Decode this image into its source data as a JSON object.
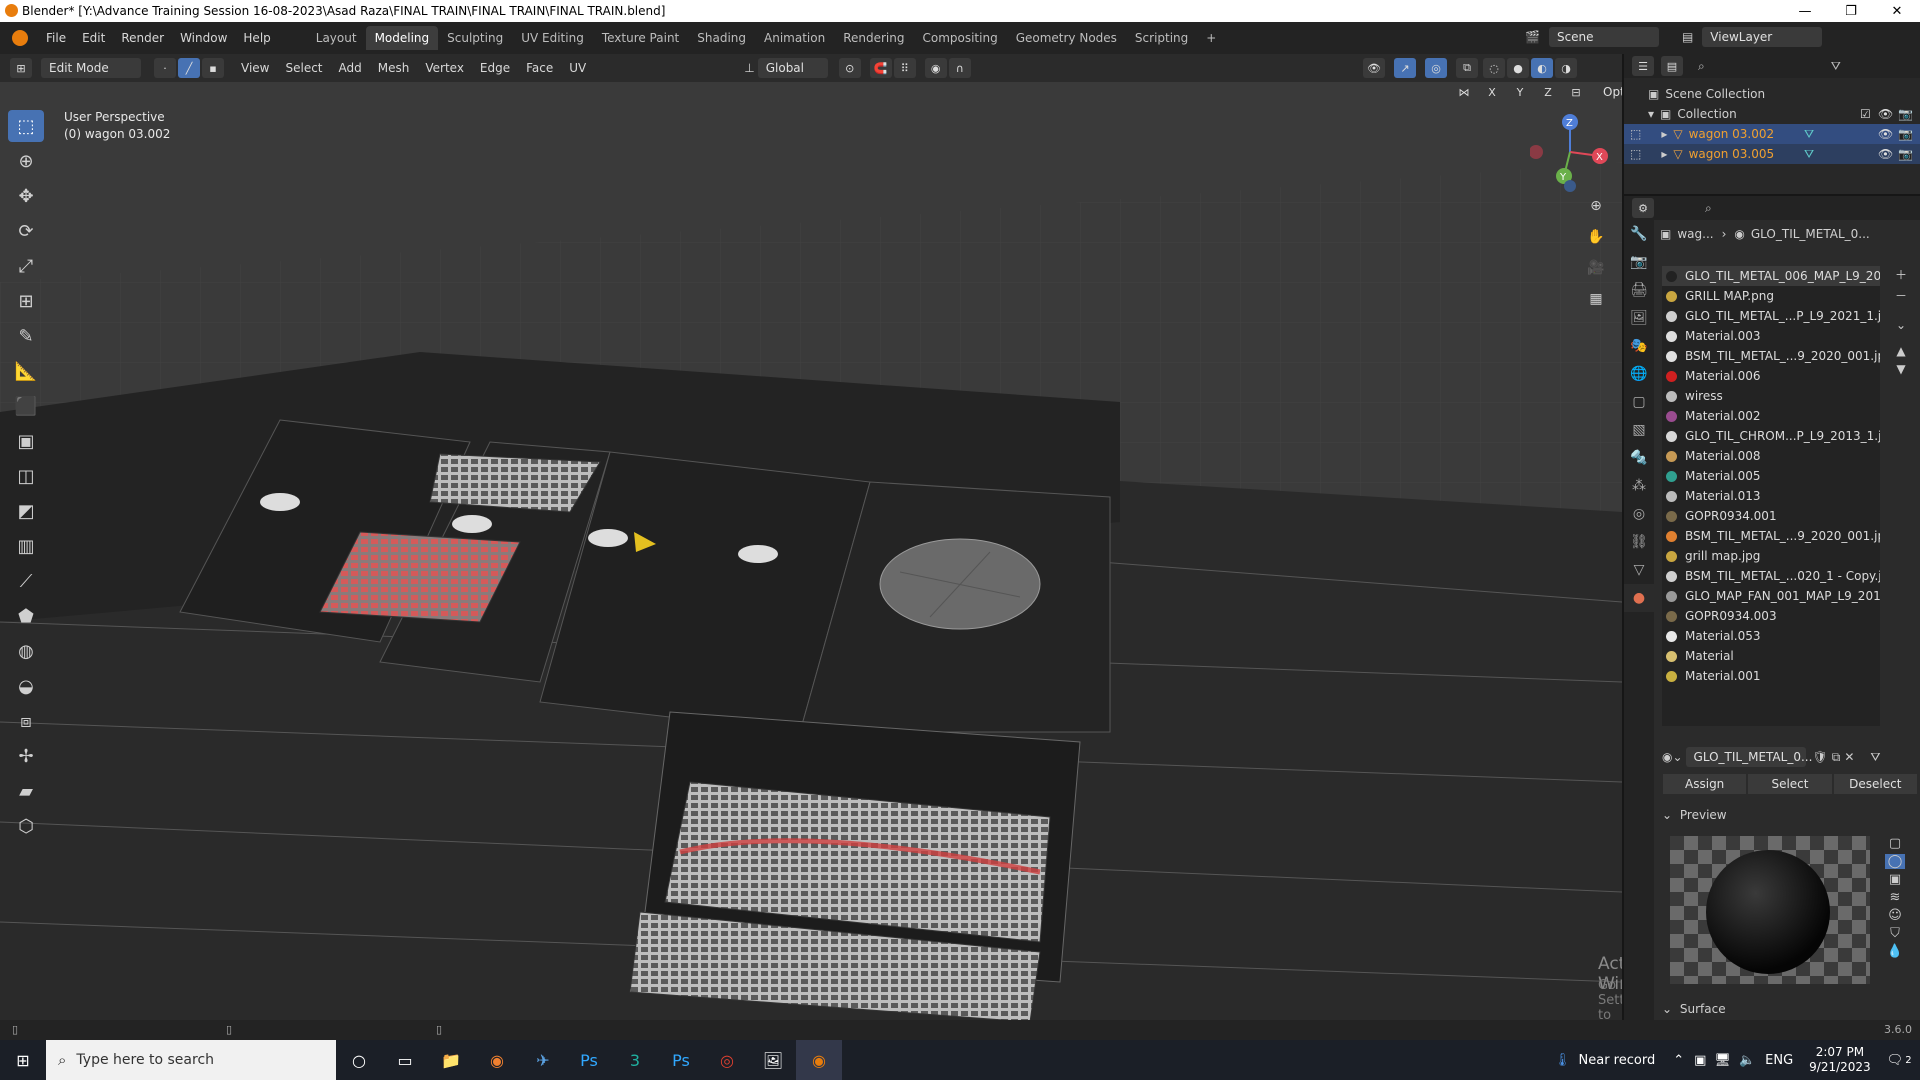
{
  "window": {
    "title": "Blender* [Y:\\Advance Training Session 16-08-2023\\Asad Raza\\FINAL TRAIN\\FINAL TRAIN\\FINAL TRAIN.blend]",
    "min": "—",
    "max": "❐",
    "close": "✕"
  },
  "menu": [
    "File",
    "Edit",
    "Render",
    "Window",
    "Help"
  ],
  "workspaces": [
    "Layout",
    "Modeling",
    "Sculpting",
    "UV Editing",
    "Texture Paint",
    "Shading",
    "Animation",
    "Rendering",
    "Compositing",
    "Geometry Nodes",
    "Scripting"
  ],
  "workspace_add": "+",
  "scene": {
    "name": "Scene",
    "view_layer": "ViewLayer"
  },
  "viewport_header": {
    "mode": "Edit Mode",
    "menus": [
      "View",
      "Select",
      "Add",
      "Mesh",
      "Vertex",
      "Edge",
      "Face",
      "UV"
    ],
    "orientation": "Global",
    "options": "Options",
    "axes": [
      "X",
      "Y",
      "Z"
    ]
  },
  "viewport": {
    "perspective": "User Perspective",
    "object": "(0) wagon 03.002",
    "watermark_title": "Activate Windows",
    "watermark_sub": "Go to Settings to activate Windows.",
    "gizmo": {
      "x": "X",
      "y": "Y",
      "z": "Z"
    }
  },
  "outliner": {
    "root": "Scene Collection",
    "collection": "Collection",
    "items": [
      {
        "name": "wagon 03.002",
        "selected": true
      },
      {
        "name": "wagon 03.005",
        "selected": false
      }
    ]
  },
  "properties": {
    "breadcrumb_obj": "wag...",
    "breadcrumb_mat": "GLO_TIL_METAL_0...",
    "materials": [
      {
        "name": "GLO_TIL_METAL_006_MAP_L9_20...",
        "color": "#222222",
        "active": true
      },
      {
        "name": "GRILL MAP.png",
        "color": "#c9a640"
      },
      {
        "name": "GLO_TIL_METAL_...P_L9_2021_1.jpg",
        "color": "#cfcfcf"
      },
      {
        "name": "Material.003",
        "color": "#dedede"
      },
      {
        "name": "BSM_TIL_METAL_...9_2020_001.jpg",
        "color": "#e0e0e0"
      },
      {
        "name": "Material.006",
        "color": "#d02020"
      },
      {
        "name": "wiress",
        "color": "#bdbdbd"
      },
      {
        "name": "Material.002",
        "color": "#9a4c90"
      },
      {
        "name": "GLO_TIL_CHROM...P_L9_2013_1.jpg",
        "color": "#d8d8d8"
      },
      {
        "name": "Material.008",
        "color": "#c79a55"
      },
      {
        "name": "Material.005",
        "color": "#30a090"
      },
      {
        "name": "Material.013",
        "color": "#bcbcbc"
      },
      {
        "name": "GOPR0934.001",
        "color": "#7a6a4a"
      },
      {
        "name": "BSM_TIL_METAL_...9_2020_001.jpg",
        "color": "#e08030"
      },
      {
        "name": "grill map.jpg",
        "color": "#c9a640"
      },
      {
        "name": "BSM_TIL_METAL_...020_1 - Copy.jpg",
        "color": "#d0d0d0"
      },
      {
        "name": "GLO_MAP_FAN_001_MAP_L9_201...",
        "color": "#9a9a9a"
      },
      {
        "name": "GOPR0934.003",
        "color": "#7a6a4a"
      },
      {
        "name": "Material.053",
        "color": "#e8e8e8"
      },
      {
        "name": "Material",
        "color": "#d8c070"
      },
      {
        "name": "Material.001",
        "color": "#c9b040"
      }
    ],
    "slot_material": "GLO_TIL_METAL_0...",
    "assign": "Assign",
    "select": "Select",
    "deselect": "Deselect",
    "preview": "Preview",
    "surface": "Surface"
  },
  "status": {
    "version": "3.6.0"
  },
  "taskbar": {
    "search_placeholder": "Type here to search",
    "weather": "Near record",
    "lang": "ENG",
    "time": "2:07 PM",
    "date": "9/21/2023",
    "notif": "2"
  }
}
